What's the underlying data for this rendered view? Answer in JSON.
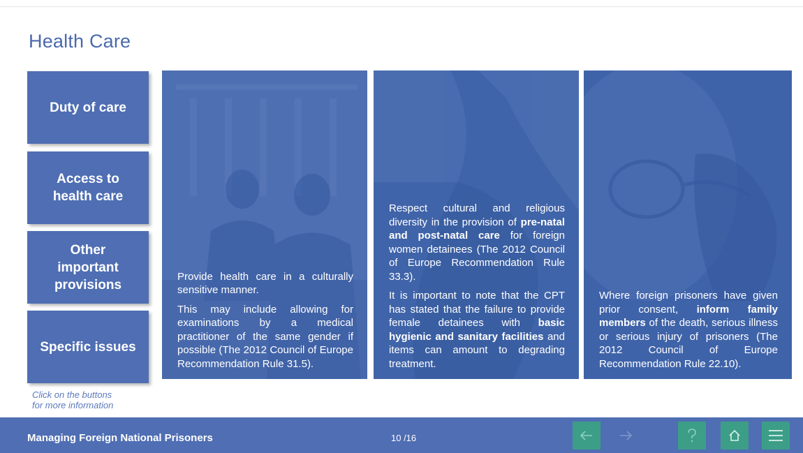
{
  "page": {
    "title": "Health Care"
  },
  "sidebar": {
    "buttons": [
      {
        "label": "Duty of care"
      },
      {
        "label": "Access to\nhealth care"
      },
      {
        "label": "Other\nimportant\nprovisions"
      },
      {
        "label": "Specific issues"
      }
    ],
    "hint": "Click on the buttons\nfor more information"
  },
  "panels": [
    {
      "paragraphs": [
        "Provide health care in a culturally sensitive manner.",
        "This may include allowing for examinations by a medical practitioner of the same gender if possible (The 2012 Council of Europe Recommendation Rule 31.5)."
      ]
    },
    {
      "p1_a": "Respect cultural and religious diversity in the provision of",
      "p1_b": "pre-natal and post-natal care",
      "p1_c": "for foreign women detainees (The 2012 Council of Europe Recommendation Rule 33.3).",
      "p2_a": "It is important to note that the CPT has stated that the failure to provide female detainees with",
      "p2_b": "basic hygienic and sanitary facilities",
      "p2_c": "and items can amount to degrading treatment."
    },
    {
      "p1_a": "Where foreign prisoners have given prior consent,",
      "p1_b": "inform family members",
      "p1_c": "of the death, serious illness or serious injury of prisoners (The 2012 Council of Europe Recommendation Rule 22.10)."
    }
  ],
  "footer": {
    "course_title": "Managing Foreign National Prisoners",
    "page_indicator": "10 /16"
  },
  "nav": {
    "prev_icon": "arrow-left-icon",
    "next_icon": "arrow-right-icon",
    "help_icon": "question-icon",
    "home_icon": "home-icon",
    "menu_icon": "hamburger-menu-icon"
  },
  "colors": {
    "accent": "#4f6eb3",
    "title": "#4a69ad",
    "panel": "#3e62a8",
    "nav_green": "#3c9e86"
  }
}
